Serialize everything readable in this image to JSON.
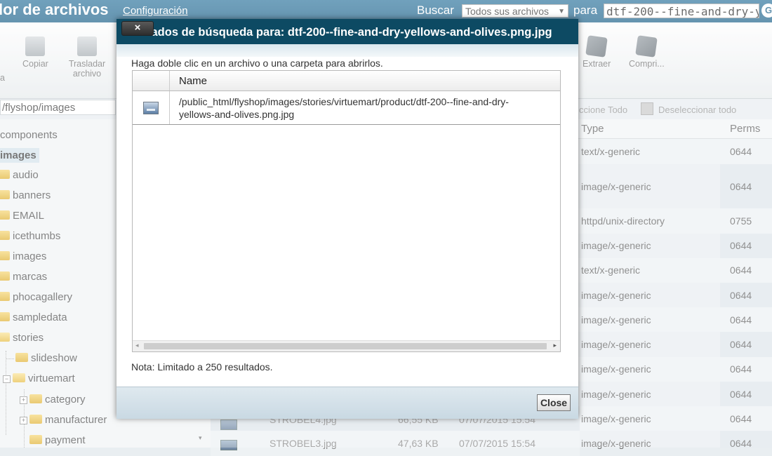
{
  "header": {
    "title": "lor de archivos",
    "config_link": "Configuración",
    "search_label": "Buscar",
    "search_scope": "Todos sus archivos",
    "para_label": "para",
    "search_value": "dtf-200--fine-and-dry-yel",
    "go_label": "G"
  },
  "toolbar": {
    "items": [
      {
        "label": "a",
        "icon": "truncated-icon"
      },
      {
        "label": "Copiar",
        "icon": "copy-icon"
      },
      {
        "label": "Trasladar archivo",
        "icon": "move-icon"
      },
      {
        "label": "Extraer",
        "icon": "extract-icon"
      },
      {
        "label": "Compri...",
        "icon": "compress-icon"
      }
    ]
  },
  "left_pane": {
    "path": "/flyshop/images",
    "tree": [
      "components",
      "images",
      "audio",
      "banners",
      "EMAIL",
      "icethumbs",
      "images",
      "marcas",
      "phocagallery",
      "sampledata",
      "stories",
      "slideshow",
      "virtuemart",
      "category",
      "manufacturer",
      "payment"
    ]
  },
  "file_list": {
    "select_all": "ccione Todo",
    "deselect_all": "Deseleccionar todo",
    "columns": {
      "type": "Type",
      "perms": "Perms"
    },
    "rows": [
      {
        "type": "text/x-generic",
        "perms": "0644"
      },
      {
        "type": "image/x-generic",
        "perms": "0644"
      },
      {
        "type": "httpd/unix-directory",
        "perms": "0755"
      },
      {
        "type": "image/x-generic",
        "perms": "0644"
      },
      {
        "type": "text/x-generic",
        "perms": "0644"
      },
      {
        "type": "image/x-generic",
        "perms": "0644"
      },
      {
        "type": "image/x-generic",
        "perms": "0644"
      },
      {
        "type": "image/x-generic",
        "perms": "0644"
      },
      {
        "type": "image/x-generic",
        "perms": "0644"
      },
      {
        "type": "image/x-generic",
        "perms": "0644"
      },
      {
        "type": "image/x-generic",
        "perms": "0644"
      },
      {
        "type": "image/x-generic",
        "perms": "0644"
      }
    ],
    "partial_rows": [
      {
        "name": "STROBEL4.jpg",
        "size": "66,55 KB",
        "date": "07/07/2015 15:54"
      },
      {
        "name": "STROBEL3.jpg",
        "size": "47,63 KB",
        "date": "07/07/2015 15:54"
      }
    ]
  },
  "modal": {
    "title": "tados de búsqueda para: dtf-200--fine-and-dry-yellows-and-olives.png.jpg",
    "close_x": "×",
    "instructions": "Haga doble clic en un archivo o una carpeta para abrirlos.",
    "column_name": "Name",
    "results": [
      {
        "path_line1": "/public_html/flyshop/images/stories/virtuemart/product/dtf-200--fine-and-dry-",
        "path_line2": "yellows-and-olives.png.jpg",
        "icon": "image-file-icon"
      }
    ],
    "note": "Nota: Limitado a 250 resultados.",
    "close_button": "Close"
  },
  "colors": {
    "header_bg": "#2a6b91",
    "modal_title_bg": "#0d4a63",
    "folder": "#e1b53c"
  }
}
